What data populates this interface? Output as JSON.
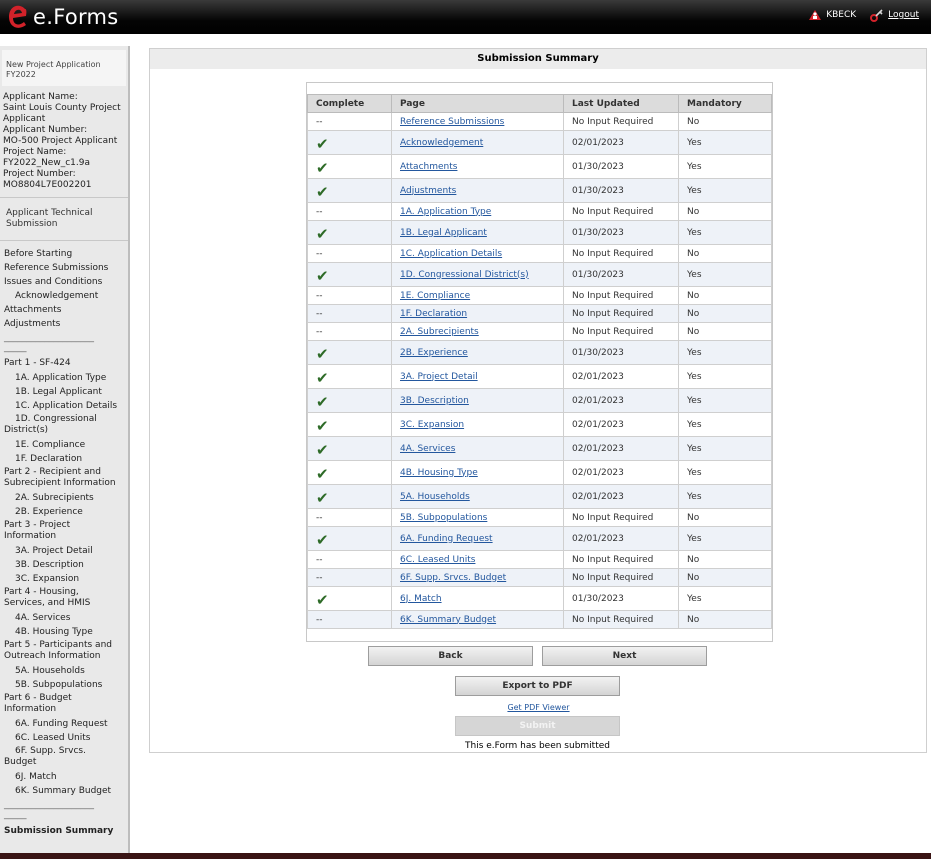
{
  "header": {
    "app_title": "e.Forms",
    "user_label": "KBECK",
    "logout_label": "Logout"
  },
  "sidebar": {
    "project_label_line1": "New Project Application",
    "project_label_line2": "FY2022",
    "info": {
      "applicant_name_label": "Applicant Name:",
      "applicant_name_line1": "Saint Louis County Project",
      "applicant_name_line2": "Applicant",
      "applicant_number_label": "Applicant Number:",
      "applicant_number": "MO-500 Project Applicant",
      "project_name_label": "Project Name:",
      "project_name": "FY2022_New_c1.9a",
      "project_number_label": "Project Number:",
      "project_number": "MO8804L7E002201"
    },
    "tech_line1": "Applicant Technical",
    "tech_line2": "Submission",
    "nav": {
      "before_starting": "Before Starting",
      "reference_submissions": "Reference Submissions",
      "issues_conditions": "Issues and Conditions",
      "acknowledgement": "Acknowledgement",
      "attachments": "Attachments",
      "adjustments": "Adjustments",
      "separator": "____________________",
      "separator_short": "_____",
      "part1": "Part 1 - SF-424",
      "p1a": "1A. Application Type",
      "p1b": "1B. Legal Applicant",
      "p1c": "1C. Application Details",
      "p1d_line1": "1D. Congressional",
      "p1d_line2": "District(s)",
      "p1e": "1E. Compliance",
      "p1f": "1F. Declaration",
      "part2_line1": "Part 2 - Recipient and",
      "part2_line2": "Subrecipient Information",
      "p2a": "2A. Subrecipients",
      "p2b": "2B. Experience",
      "part3_line1": "Part 3 - Project",
      "part3_line2": "Information",
      "p3a": "3A. Project Detail",
      "p3b": "3B. Description",
      "p3c": "3C. Expansion",
      "part4_line1": "Part 4 - Housing,",
      "part4_line2": "Services, and HMIS",
      "p4a": "4A. Services",
      "p4b": "4B. Housing Type",
      "part5_line1": "Part 5 - Participants and",
      "part5_line2": "Outreach Information",
      "p5a": "5A. Households",
      "p5b": "5B. Subpopulations",
      "part6_line1": "Part 6 - Budget",
      "part6_line2": "Information",
      "p6a": "6A. Funding Request",
      "p6c": "6C. Leased Units",
      "p6f_line1": "6F. Supp. Srvcs.",
      "p6f_line2": "Budget",
      "p6j": "6J. Match",
      "p6k": "6K. Summary Budget",
      "submission_summary": "Submission Summary"
    }
  },
  "main": {
    "title": "Submission Summary",
    "columns": [
      "Complete",
      "Page",
      "Last Updated",
      "Mandatory"
    ],
    "rows": [
      {
        "complete": "--",
        "page": "Reference Submissions",
        "updated": "No Input Required",
        "mandatory": "No"
      },
      {
        "complete": "check",
        "page": "Acknowledgement",
        "updated": "02/01/2023",
        "mandatory": "Yes"
      },
      {
        "complete": "check",
        "page": "Attachments",
        "updated": "01/30/2023",
        "mandatory": "Yes"
      },
      {
        "complete": "check",
        "page": "Adjustments",
        "updated": "01/30/2023",
        "mandatory": "Yes"
      },
      {
        "complete": "--",
        "page": "1A. Application Type",
        "updated": "No Input Required",
        "mandatory": "No"
      },
      {
        "complete": "check",
        "page": "1B. Legal Applicant",
        "updated": "01/30/2023",
        "mandatory": "Yes"
      },
      {
        "complete": "--",
        "page": "1C. Application Details",
        "updated": "No Input Required",
        "mandatory": "No"
      },
      {
        "complete": "check",
        "page": "1D. Congressional District(s)",
        "updated": "01/30/2023",
        "mandatory": "Yes"
      },
      {
        "complete": "--",
        "page": "1E. Compliance",
        "updated": "No Input Required",
        "mandatory": "No"
      },
      {
        "complete": "--",
        "page": "1F. Declaration",
        "updated": "No Input Required",
        "mandatory": "No"
      },
      {
        "complete": "--",
        "page": "2A. Subrecipients",
        "updated": "No Input Required",
        "mandatory": "No"
      },
      {
        "complete": "check",
        "page": "2B. Experience",
        "updated": "01/30/2023",
        "mandatory": "Yes"
      },
      {
        "complete": "check",
        "page": "3A. Project Detail",
        "updated": "02/01/2023",
        "mandatory": "Yes"
      },
      {
        "complete": "check",
        "page": "3B. Description",
        "updated": "02/01/2023",
        "mandatory": "Yes"
      },
      {
        "complete": "check",
        "page": "3C. Expansion",
        "updated": "02/01/2023",
        "mandatory": "Yes"
      },
      {
        "complete": "check",
        "page": "4A. Services",
        "updated": "02/01/2023",
        "mandatory": "Yes"
      },
      {
        "complete": "check",
        "page": "4B. Housing Type",
        "updated": "02/01/2023",
        "mandatory": "Yes"
      },
      {
        "complete": "check",
        "page": "5A. Households",
        "updated": "02/01/2023",
        "mandatory": "Yes"
      },
      {
        "complete": "--",
        "page": "5B. Subpopulations",
        "updated": "No Input Required",
        "mandatory": "No"
      },
      {
        "complete": "check",
        "page": "6A. Funding Request",
        "updated": "02/01/2023",
        "mandatory": "Yes"
      },
      {
        "complete": "--",
        "page": "6C. Leased Units",
        "updated": "No Input Required",
        "mandatory": "No"
      },
      {
        "complete": "--",
        "page": "6F. Supp. Srvcs. Budget",
        "updated": "No Input Required",
        "mandatory": "No"
      },
      {
        "complete": "check",
        "page": "6J. Match",
        "updated": "01/30/2023",
        "mandatory": "Yes"
      },
      {
        "complete": "--",
        "page": "6K. Summary Budget",
        "updated": "No Input Required",
        "mandatory": "No"
      }
    ],
    "back_label": "Back",
    "next_label": "Next",
    "export_label": "Export to PDF",
    "pdf_viewer_label": "Get PDF Viewer",
    "submit_label": "Submit",
    "submitted_text": "This e.Form has been submitted"
  },
  "colors": {
    "check_green": "#2e6b28",
    "link_blue": "#23579e",
    "logo_red": "#d2222a"
  }
}
